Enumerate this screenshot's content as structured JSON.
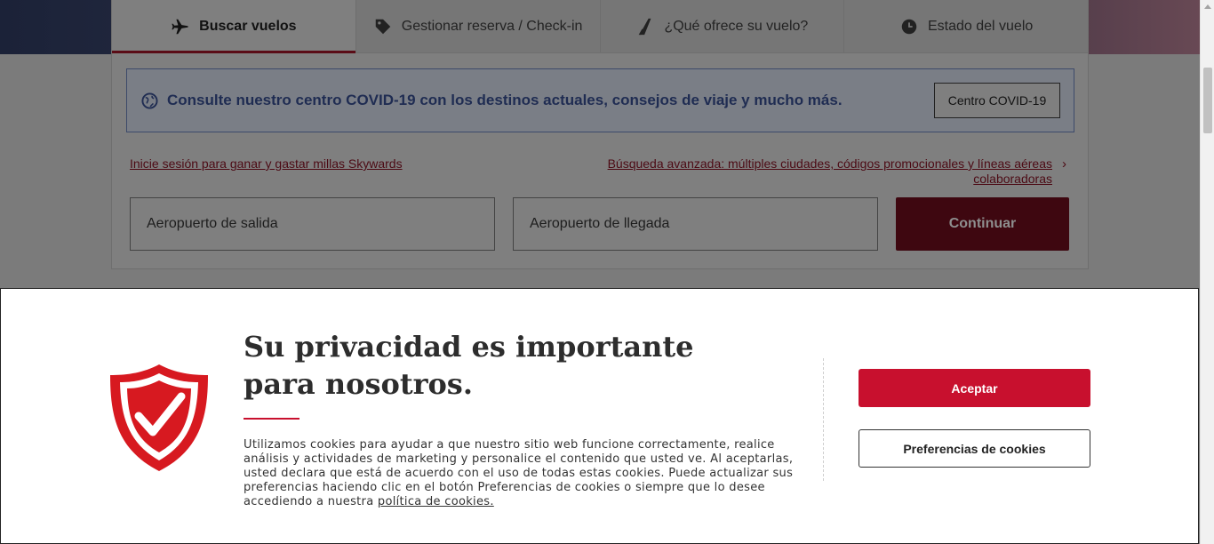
{
  "tabs": [
    {
      "label": "Buscar vuelos",
      "icon": "plane-icon",
      "active": true
    },
    {
      "label": "Gestionar reserva / Check-in",
      "icon": "tag-icon",
      "active": false
    },
    {
      "label": "¿Qué ofrece su vuelo?",
      "icon": "tail-fin-icon",
      "active": false
    },
    {
      "label": "Estado del vuelo",
      "icon": "clock-icon",
      "active": false
    }
  ],
  "covid": {
    "icon": "globe-icon",
    "text": "Consulte nuestro centro COVID-19 con los destinos actuales, consejos de viaje y mucho más.",
    "button": "Centro COVID-19"
  },
  "links": {
    "login": "Inicie sesión para ganar y gastar millas Skywards",
    "advanced": "Búsqueda avanzada: múltiples ciudades, códigos promocionales y líneas aéreas colaboradoras",
    "advanced_chevron": "›"
  },
  "search": {
    "departure_placeholder": "Aeropuerto de salida",
    "arrival_placeholder": "Aeropuerto de llegada",
    "continue": "Continuar"
  },
  "cookie": {
    "icon": "shield-check-icon",
    "title": "Su privacidad es importante para nosotros.",
    "body": "Utilizamos cookies para ayudar a que nuestro sitio web funcione correctamente, realice análisis y actividades de marketing y personalice el contenido que usted ve. Al aceptarlas, usted declara que está de acuerdo con el uso de todas estas cookies. Puede actualizar sus preferencias haciendo clic en el botón Preferencias de cookies o siempre que lo desee accediendo a nuestra ",
    "policy_link": "política de cookies.",
    "accept": "Aceptar",
    "preferences": "Preferencias de cookies"
  },
  "colors": {
    "brand_red": "#c8102e",
    "covid_blue": "#2a4b9b"
  }
}
